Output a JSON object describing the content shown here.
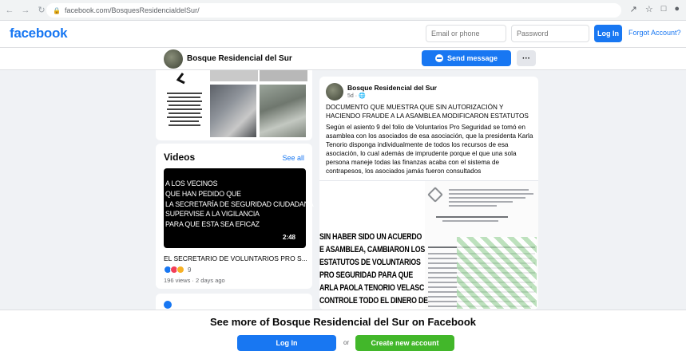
{
  "browser": {
    "url": "facebook.com/BosquesResidencialdelSur/"
  },
  "topbar": {
    "logo": "facebook",
    "email_placeholder": "Email or phone",
    "password_placeholder": "Password",
    "login_label": "Log In",
    "forgot_label": "Forgot Account?"
  },
  "page": {
    "name": "Bosque Residencial del Sur",
    "send_message_label": "Send message",
    "more_label": "···"
  },
  "videos": {
    "title": "Videos",
    "see_all": "See all",
    "thumb_lines": [
      "A LOS VECINOS",
      "QUE HAN PEDIDO QUE",
      "LA SECRETARÍA DE SEGURIDAD CIUDADANA",
      "SUPERVISE  A LA VIGILANCIA",
      "PARA QUE ESTA SEA EFICAZ"
    ],
    "duration": "2:48",
    "video_title": "EL SECRETARIO DE VOLUNTARIOS PRO S...",
    "reaction_count": "9",
    "meta": "196 views · 2 days ago"
  },
  "post": {
    "author": "Bosque Residencial del Sur",
    "time": "5d · ",
    "headline": "DOCUMENTO QUE MUESTRA QUE SIN AUTORIZACIÓN Y HACIENDO FRAUDE A LA ASAMBLEA MODIFICARON ESTATUTOS",
    "body": "Según el asiento 9 del folio de Voluntarios Pro Seguridad se tomó en asamblea con los asociados de esa asociación, que la presidenta Karla Tenorio disponga individualmente de todos los recursos de esa asociación, lo cual además de imprudente porque el que una sola persona maneje todas las finanzas acaba con el sistema de contrapesos, los asociados jamás fueron consultados",
    "overlay_lines": [
      "SIN HABER SIDO UN ACUERDO",
      "E ASAMBLEA, CAMBIARON LOS",
      "ESTATUTOS DE VOLUNTARIOS",
      "PRO SEGURIDAD PARA QUE",
      "ARLA PAOLA TENORIO VELASC",
      "CONTROLE TODO EL DINERO DE"
    ]
  },
  "bottom": {
    "cta": "See more of Bosque Residencial del Sur on Facebook",
    "login_label": "Log In",
    "or": "or",
    "create_label": "Create new account"
  },
  "colors": {
    "brand": "#1877f2",
    "create": "#42b72a",
    "background": "#f0f2f5"
  }
}
